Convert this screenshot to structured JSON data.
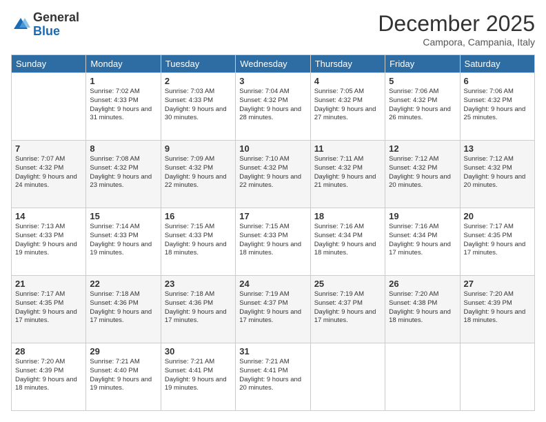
{
  "header": {
    "logo_general": "General",
    "logo_blue": "Blue",
    "month": "December 2025",
    "location": "Campora, Campania, Italy"
  },
  "days_of_week": [
    "Sunday",
    "Monday",
    "Tuesday",
    "Wednesday",
    "Thursday",
    "Friday",
    "Saturday"
  ],
  "weeks": [
    [
      {
        "day": "",
        "sunrise": "",
        "sunset": "",
        "daylight": ""
      },
      {
        "day": "1",
        "sunrise": "Sunrise: 7:02 AM",
        "sunset": "Sunset: 4:33 PM",
        "daylight": "Daylight: 9 hours and 31 minutes."
      },
      {
        "day": "2",
        "sunrise": "Sunrise: 7:03 AM",
        "sunset": "Sunset: 4:33 PM",
        "daylight": "Daylight: 9 hours and 30 minutes."
      },
      {
        "day": "3",
        "sunrise": "Sunrise: 7:04 AM",
        "sunset": "Sunset: 4:32 PM",
        "daylight": "Daylight: 9 hours and 28 minutes."
      },
      {
        "day": "4",
        "sunrise": "Sunrise: 7:05 AM",
        "sunset": "Sunset: 4:32 PM",
        "daylight": "Daylight: 9 hours and 27 minutes."
      },
      {
        "day": "5",
        "sunrise": "Sunrise: 7:06 AM",
        "sunset": "Sunset: 4:32 PM",
        "daylight": "Daylight: 9 hours and 26 minutes."
      },
      {
        "day": "6",
        "sunrise": "Sunrise: 7:06 AM",
        "sunset": "Sunset: 4:32 PM",
        "daylight": "Daylight: 9 hours and 25 minutes."
      }
    ],
    [
      {
        "day": "7",
        "sunrise": "Sunrise: 7:07 AM",
        "sunset": "Sunset: 4:32 PM",
        "daylight": "Daylight: 9 hours and 24 minutes."
      },
      {
        "day": "8",
        "sunrise": "Sunrise: 7:08 AM",
        "sunset": "Sunset: 4:32 PM",
        "daylight": "Daylight: 9 hours and 23 minutes."
      },
      {
        "day": "9",
        "sunrise": "Sunrise: 7:09 AM",
        "sunset": "Sunset: 4:32 PM",
        "daylight": "Daylight: 9 hours and 22 minutes."
      },
      {
        "day": "10",
        "sunrise": "Sunrise: 7:10 AM",
        "sunset": "Sunset: 4:32 PM",
        "daylight": "Daylight: 9 hours and 22 minutes."
      },
      {
        "day": "11",
        "sunrise": "Sunrise: 7:11 AM",
        "sunset": "Sunset: 4:32 PM",
        "daylight": "Daylight: 9 hours and 21 minutes."
      },
      {
        "day": "12",
        "sunrise": "Sunrise: 7:12 AM",
        "sunset": "Sunset: 4:32 PM",
        "daylight": "Daylight: 9 hours and 20 minutes."
      },
      {
        "day": "13",
        "sunrise": "Sunrise: 7:12 AM",
        "sunset": "Sunset: 4:32 PM",
        "daylight": "Daylight: 9 hours and 20 minutes."
      }
    ],
    [
      {
        "day": "14",
        "sunrise": "Sunrise: 7:13 AM",
        "sunset": "Sunset: 4:33 PM",
        "daylight": "Daylight: 9 hours and 19 minutes."
      },
      {
        "day": "15",
        "sunrise": "Sunrise: 7:14 AM",
        "sunset": "Sunset: 4:33 PM",
        "daylight": "Daylight: 9 hours and 19 minutes."
      },
      {
        "day": "16",
        "sunrise": "Sunrise: 7:15 AM",
        "sunset": "Sunset: 4:33 PM",
        "daylight": "Daylight: 9 hours and 18 minutes."
      },
      {
        "day": "17",
        "sunrise": "Sunrise: 7:15 AM",
        "sunset": "Sunset: 4:33 PM",
        "daylight": "Daylight: 9 hours and 18 minutes."
      },
      {
        "day": "18",
        "sunrise": "Sunrise: 7:16 AM",
        "sunset": "Sunset: 4:34 PM",
        "daylight": "Daylight: 9 hours and 18 minutes."
      },
      {
        "day": "19",
        "sunrise": "Sunrise: 7:16 AM",
        "sunset": "Sunset: 4:34 PM",
        "daylight": "Daylight: 9 hours and 17 minutes."
      },
      {
        "day": "20",
        "sunrise": "Sunrise: 7:17 AM",
        "sunset": "Sunset: 4:35 PM",
        "daylight": "Daylight: 9 hours and 17 minutes."
      }
    ],
    [
      {
        "day": "21",
        "sunrise": "Sunrise: 7:17 AM",
        "sunset": "Sunset: 4:35 PM",
        "daylight": "Daylight: 9 hours and 17 minutes."
      },
      {
        "day": "22",
        "sunrise": "Sunrise: 7:18 AM",
        "sunset": "Sunset: 4:36 PM",
        "daylight": "Daylight: 9 hours and 17 minutes."
      },
      {
        "day": "23",
        "sunrise": "Sunrise: 7:18 AM",
        "sunset": "Sunset: 4:36 PM",
        "daylight": "Daylight: 9 hours and 17 minutes."
      },
      {
        "day": "24",
        "sunrise": "Sunrise: 7:19 AM",
        "sunset": "Sunset: 4:37 PM",
        "daylight": "Daylight: 9 hours and 17 minutes."
      },
      {
        "day": "25",
        "sunrise": "Sunrise: 7:19 AM",
        "sunset": "Sunset: 4:37 PM",
        "daylight": "Daylight: 9 hours and 17 minutes."
      },
      {
        "day": "26",
        "sunrise": "Sunrise: 7:20 AM",
        "sunset": "Sunset: 4:38 PM",
        "daylight": "Daylight: 9 hours and 18 minutes."
      },
      {
        "day": "27",
        "sunrise": "Sunrise: 7:20 AM",
        "sunset": "Sunset: 4:39 PM",
        "daylight": "Daylight: 9 hours and 18 minutes."
      }
    ],
    [
      {
        "day": "28",
        "sunrise": "Sunrise: 7:20 AM",
        "sunset": "Sunset: 4:39 PM",
        "daylight": "Daylight: 9 hours and 18 minutes."
      },
      {
        "day": "29",
        "sunrise": "Sunrise: 7:21 AM",
        "sunset": "Sunset: 4:40 PM",
        "daylight": "Daylight: 9 hours and 19 minutes."
      },
      {
        "day": "30",
        "sunrise": "Sunrise: 7:21 AM",
        "sunset": "Sunset: 4:41 PM",
        "daylight": "Daylight: 9 hours and 19 minutes."
      },
      {
        "day": "31",
        "sunrise": "Sunrise: 7:21 AM",
        "sunset": "Sunset: 4:41 PM",
        "daylight": "Daylight: 9 hours and 20 minutes."
      },
      {
        "day": "",
        "sunrise": "",
        "sunset": "",
        "daylight": ""
      },
      {
        "day": "",
        "sunrise": "",
        "sunset": "",
        "daylight": ""
      },
      {
        "day": "",
        "sunrise": "",
        "sunset": "",
        "daylight": ""
      }
    ]
  ]
}
